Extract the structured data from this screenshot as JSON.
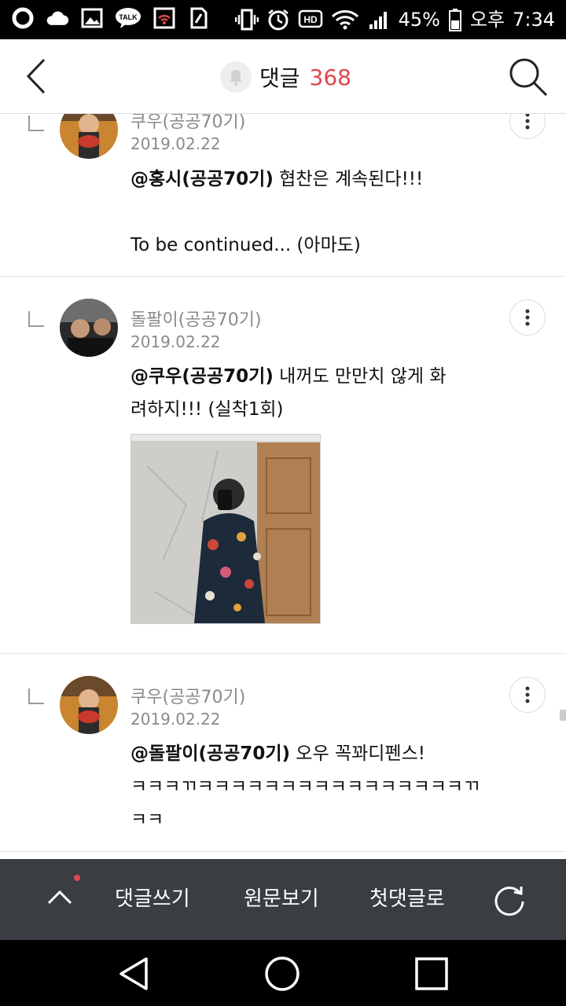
{
  "status_bar": {
    "battery_percent": "45%",
    "ampm": "오후",
    "time": "7:34",
    "icons": [
      "opera-icon",
      "cloud-icon",
      "gallery-icon",
      "kakaotalk-icon",
      "wifi-alert-icon",
      "sim-icon",
      "vibrate-icon",
      "alarm-icon",
      "hd-icon",
      "wifi-icon",
      "signal-icon",
      "battery-icon"
    ],
    "talk_label": "TALK",
    "hd_label": "HD"
  },
  "header": {
    "title": "댓글",
    "count": "368"
  },
  "comments": [
    {
      "name": "쿠우(공공70기)",
      "date": "2019.02.22",
      "mention": "@홍시(공공70기)",
      "text": " 협찬은 계속된다!!!\n\nTo be continued... (아마도)"
    },
    {
      "name": "돌팔이(공공70기)",
      "date": "2019.02.22",
      "mention": "@쿠우(공공70기)",
      "text": " 내꺼도 만만치 않게 화려하지!!! (실착1회)",
      "has_photo": true
    },
    {
      "name": "쿠우(공공70기)",
      "date": "2019.02.22",
      "mention": "@돌팔이(공공70기)",
      "text": " 오우 꼭꽈디펜스!\nㅋㅋㅋㄲㅋㅋㅋㅋㅋㅋㅋㅋㅋㅋㅋㅋㅋㅋㅋㅋㄲ\nㅋㅋ"
    }
  ],
  "bottom_bar": {
    "write": "댓글쓰기",
    "original": "원문보기",
    "first": "첫댓글로"
  },
  "colors": {
    "accent": "#e0474c",
    "toolbar_bg": "#3a3d42"
  }
}
